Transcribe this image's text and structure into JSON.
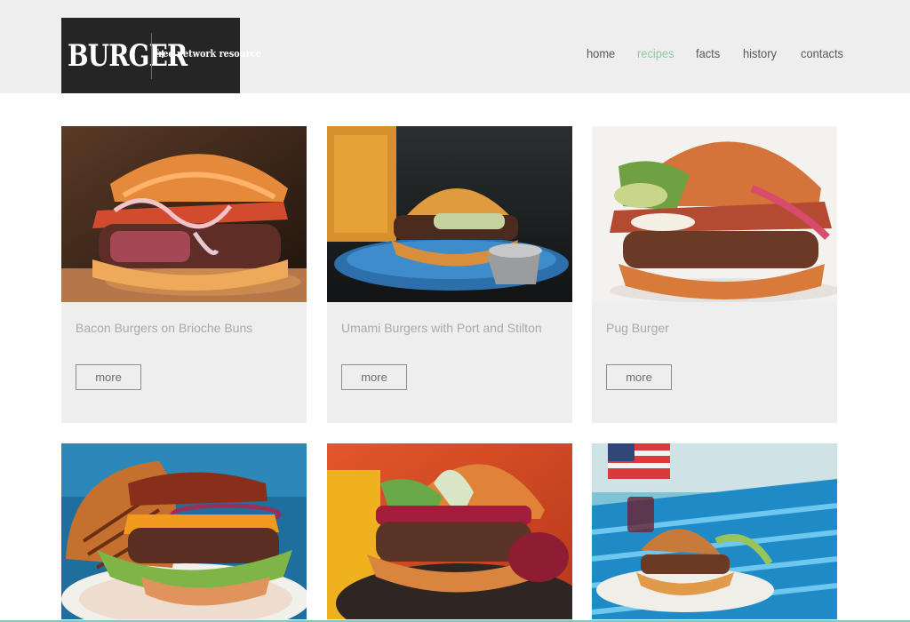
{
  "header": {
    "logo": {
      "word": "BURGER",
      "tagline": "free network resource"
    },
    "nav": [
      {
        "label": "home",
        "active": false
      },
      {
        "label": "recipes",
        "active": true
      },
      {
        "label": "facts",
        "active": false
      },
      {
        "label": "history",
        "active": false
      },
      {
        "label": "contacts",
        "active": false
      }
    ]
  },
  "recipes": [
    {
      "title": "Bacon Burgers on Brioche Buns",
      "button": "more"
    },
    {
      "title": "Umami Burgers with Port and Stilton",
      "button": "more"
    },
    {
      "title": "Pug Burger",
      "button": "more"
    },
    {
      "title": "",
      "button": ""
    },
    {
      "title": "",
      "button": ""
    },
    {
      "title": "",
      "button": ""
    }
  ],
  "colors": {
    "header_bg": "#efeeee",
    "logo_bg": "#262525",
    "nav_text": "#555b5f",
    "nav_active": "#8fc7a1",
    "card_bg": "#efeeee",
    "card_title": "#a9a9a9"
  }
}
